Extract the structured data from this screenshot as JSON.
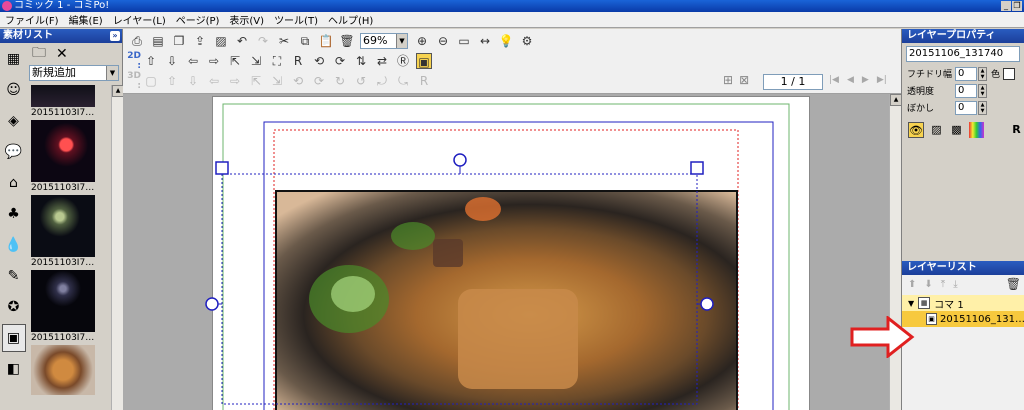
{
  "window": {
    "title": "コミック 1 - コミPo!",
    "controls": [
      "_",
      "❐"
    ]
  },
  "menu": {
    "items": [
      "ファイル(F)",
      "編集(E)",
      "レイヤー(L)",
      "ページ(P)",
      "表示(V)",
      "ツール(T)",
      "ヘルプ(H)"
    ]
  },
  "materials": {
    "header": "素材リスト",
    "collapse_icon": "»",
    "dropdown_value": "新規追加",
    "thumb_labels": [
      "20151103I7…",
      "20151103I7…",
      "20151103I7…",
      "20151103I7…"
    ]
  },
  "toolbar": {
    "row2_label": "2D :",
    "row3_label": "3D :",
    "zoom_value": "69%",
    "page_value": "1 / 1"
  },
  "properties": {
    "header": "レイヤープロパティ",
    "layer_name": "20151106_131740",
    "border_label": "フチドリ幅",
    "border_value": "0",
    "color_label": "色",
    "opacity_label": "透明度",
    "opacity_value": "0",
    "blur_label": "ぼかし",
    "blur_value": "0",
    "r_label": "R"
  },
  "layers": {
    "header": "レイヤーリスト",
    "koma_label": "コマ 1",
    "image_label": "20151106_131…"
  },
  "colors": {
    "header_blue": "#1c3f9a",
    "selection": "#f7c93e",
    "arrow_red": "#e02020"
  }
}
